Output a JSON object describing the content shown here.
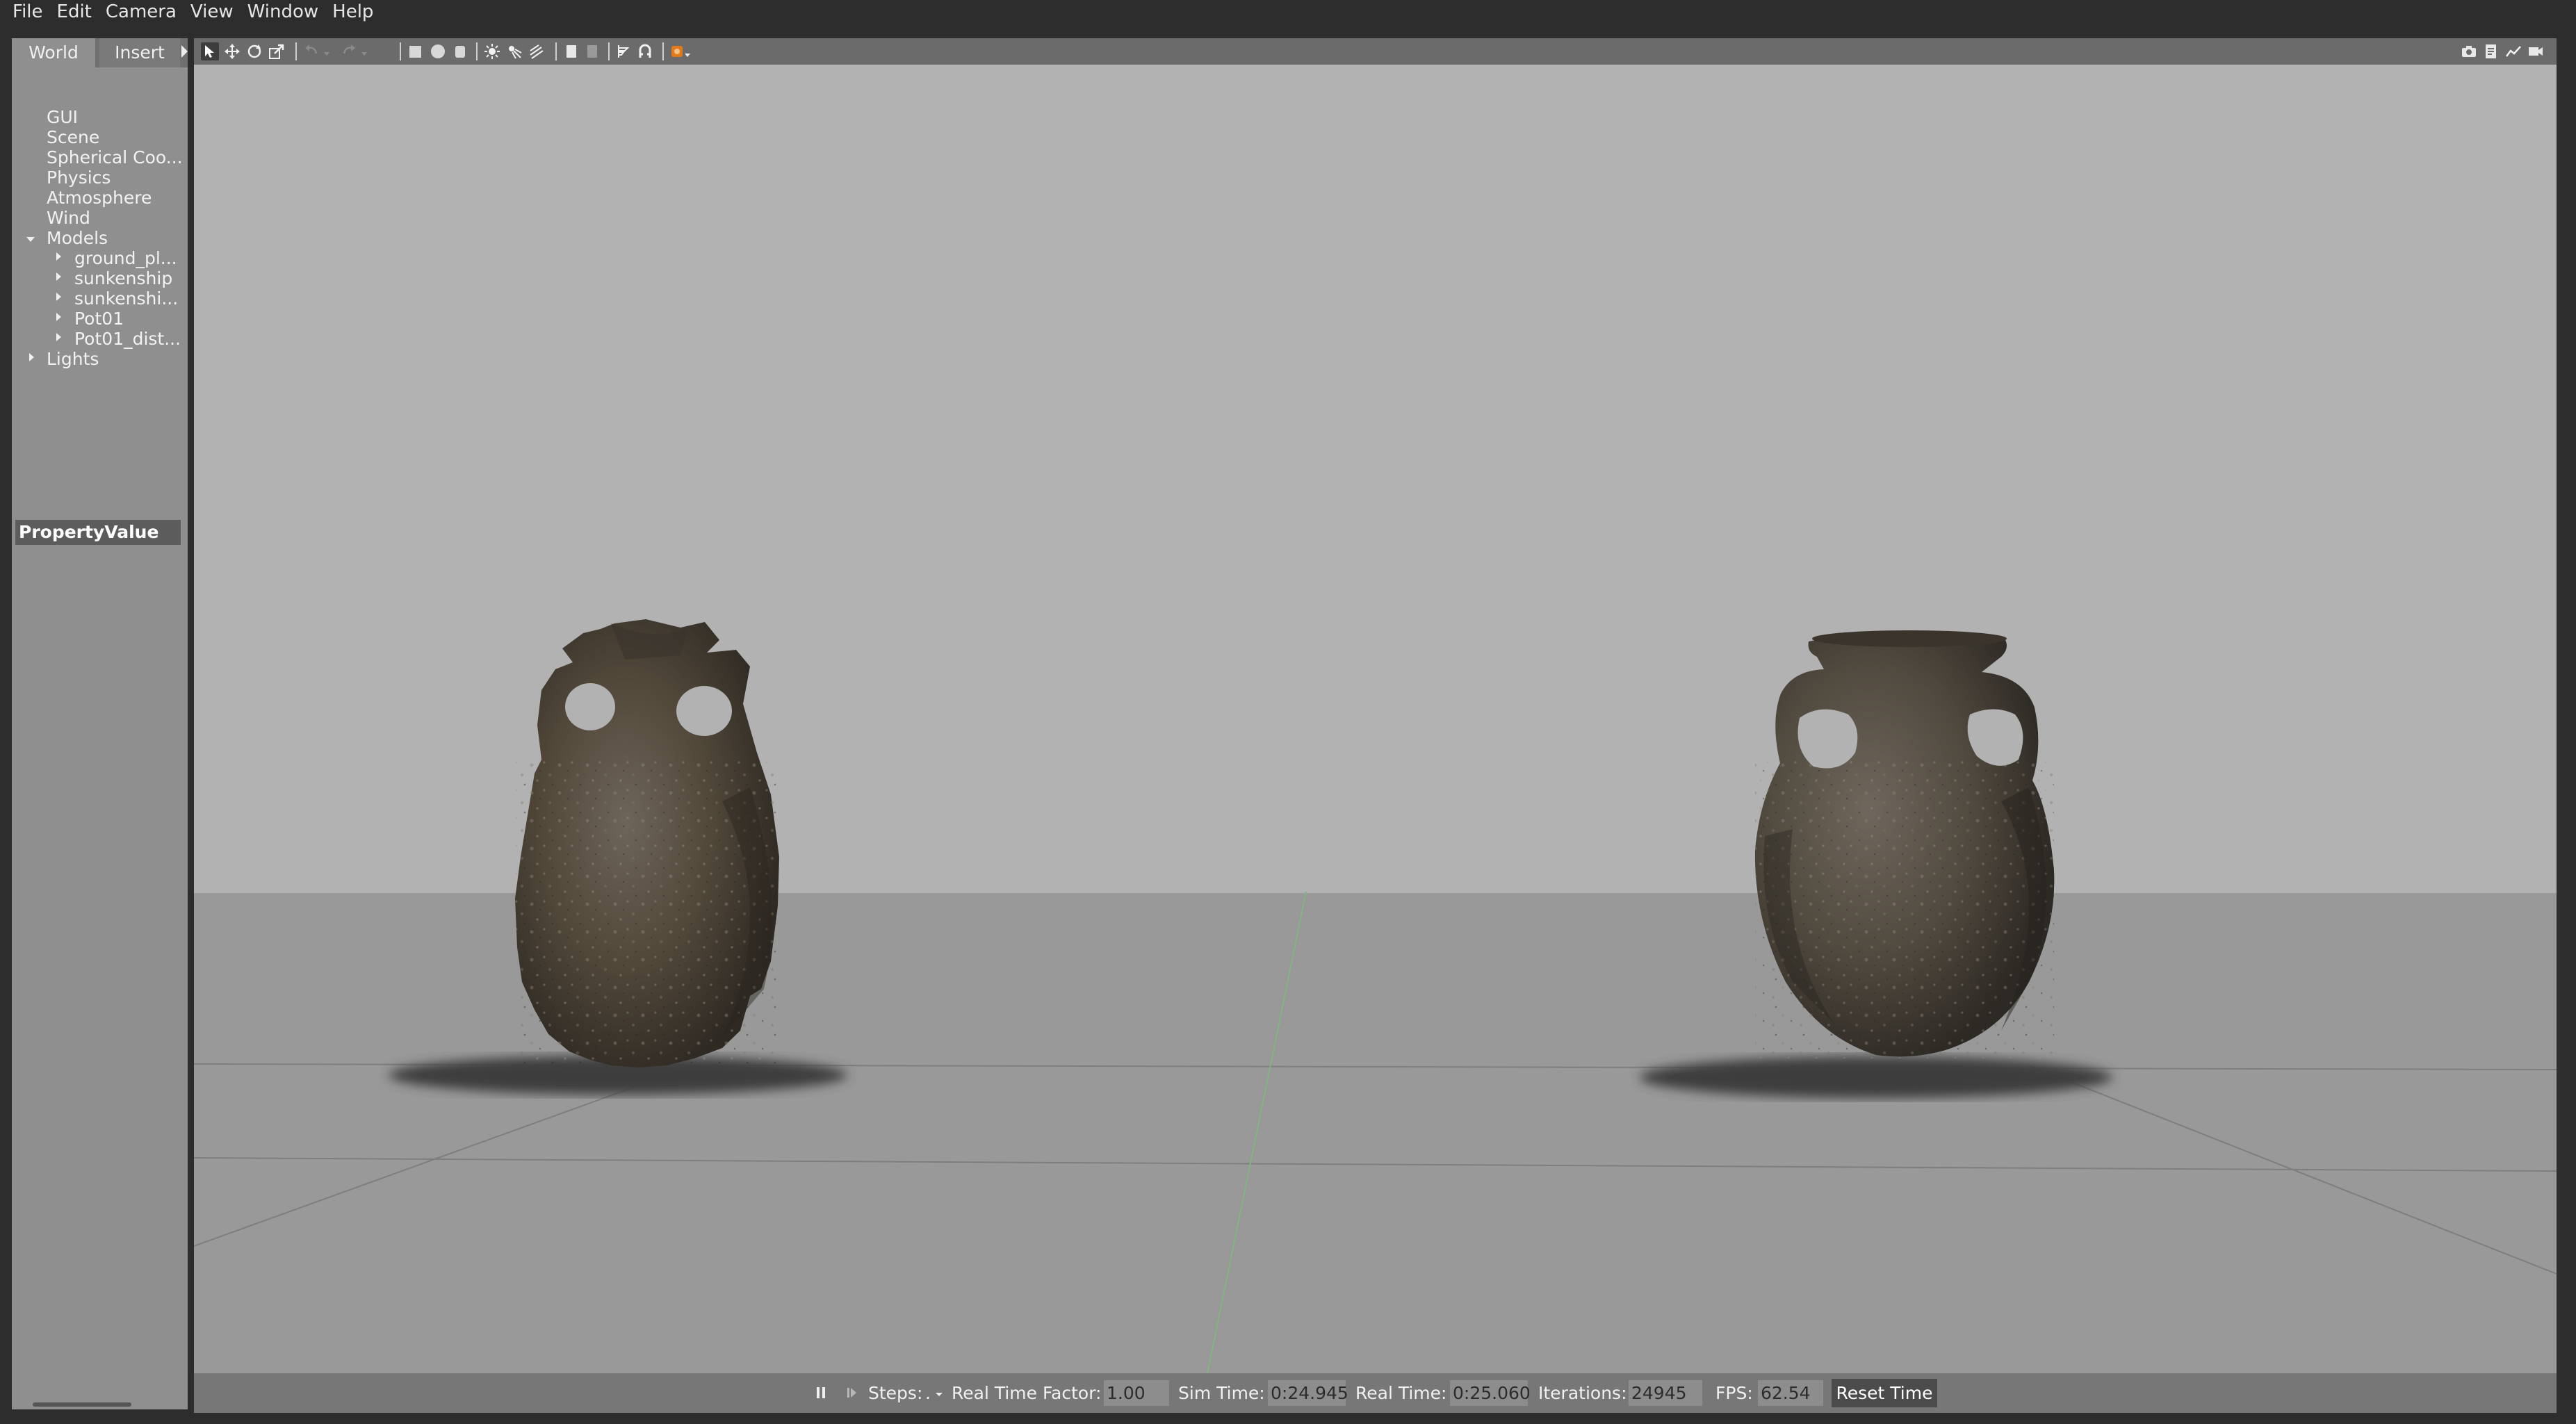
{
  "menu": {
    "file": "File",
    "edit": "Edit",
    "camera": "Camera",
    "view": "View",
    "window": "Window",
    "help": "Help"
  },
  "panel": {
    "tab_world": "World",
    "tab_insert": "Insert",
    "tree": {
      "gui": "GUI",
      "scene": "Scene",
      "spherical": "Spherical Coo...",
      "physics": "Physics",
      "atmosphere": "Atmosphere",
      "wind": "Wind",
      "models": "Models",
      "model_items": [
        "ground_pl...",
        "sunkenship",
        "sunkenshi...",
        "Pot01",
        "Pot01_dist..."
      ],
      "lights": "Lights"
    },
    "property_header": "PropertyValue"
  },
  "status": {
    "steps_label": "Steps:",
    "steps_value": ".",
    "rtf_label": "Real Time Factor:",
    "rtf_value": "1.00",
    "sim_time_label": "Sim Time:",
    "sim_time_value": "0:24.945",
    "real_time_label": "Real Time:",
    "real_time_value": "0:25.060",
    "iterations_label": "Iterations:",
    "iterations_value": "24945",
    "fps_label": "FPS:",
    "fps_value": "62.54",
    "reset_label": "Reset Time"
  },
  "colors": {
    "sky": "#b2b2b2",
    "ground": "#999999",
    "pot": "#4a4238",
    "toolbar": "#6b6b6b",
    "accent_orange": "#e07a1a"
  },
  "toolbar_icons": [
    "select-icon",
    "translate-icon",
    "rotate-icon",
    "scale-icon",
    "undo-icon",
    "redo-icon",
    "box-icon",
    "sphere-icon",
    "cylinder-icon",
    "point-light-icon",
    "spot-light-icon",
    "directional-light-icon",
    "copy-icon",
    "paste-icon",
    "align-icon",
    "snap-icon",
    "view-angle-icon",
    "screenshot-icon",
    "log-icon",
    "plot-icon",
    "video-icon"
  ]
}
